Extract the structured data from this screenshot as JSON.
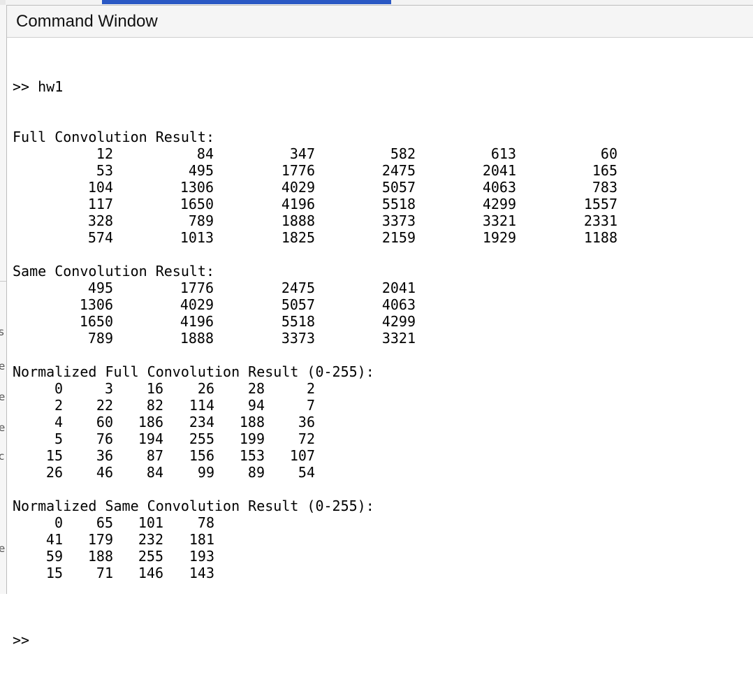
{
  "window": {
    "title": "Command Window"
  },
  "left_panel_fragments": [
    "s",
    "e",
    "e",
    "e",
    "c",
    "e"
  ],
  "console": {
    "command_line": ">> hw1",
    "prompt": ">>",
    "sections": [
      {
        "id": "full",
        "header": "Full Convolution Result:",
        "rows": [
          [
            "12",
            "84",
            "347",
            "582",
            "613",
            "60"
          ],
          [
            "53",
            "495",
            "1776",
            "2475",
            "2041",
            "165"
          ],
          [
            "104",
            "1306",
            "4029",
            "5057",
            "4063",
            "783"
          ],
          [
            "117",
            "1650",
            "4196",
            "5518",
            "4299",
            "1557"
          ],
          [
            "328",
            "789",
            "1888",
            "3373",
            "3321",
            "2331"
          ],
          [
            "574",
            "1013",
            "1825",
            "2159",
            "1929",
            "1188"
          ]
        ]
      },
      {
        "id": "same",
        "header": "Same Convolution Result:",
        "rows": [
          [
            "495",
            "1776",
            "2475",
            "2041"
          ],
          [
            "1306",
            "4029",
            "5057",
            "4063"
          ],
          [
            "1650",
            "4196",
            "5518",
            "4299"
          ],
          [
            "789",
            "1888",
            "3373",
            "3321"
          ]
        ]
      },
      {
        "id": "norm_full",
        "header": "Normalized Full Convolution Result (0-255):",
        "rows": [
          [
            "0",
            "3",
            "16",
            "26",
            "28",
            "2"
          ],
          [
            "2",
            "22",
            "82",
            "114",
            "94",
            "7"
          ],
          [
            "4",
            "60",
            "186",
            "234",
            "188",
            "36"
          ],
          [
            "5",
            "76",
            "194",
            "255",
            "199",
            "72"
          ],
          [
            "15",
            "36",
            "87",
            "156",
            "153",
            "107"
          ],
          [
            "26",
            "46",
            "84",
            "99",
            "89",
            "54"
          ]
        ]
      },
      {
        "id": "norm_same",
        "header": "Normalized Same Convolution Result (0-255):",
        "rows": [
          [
            "0",
            "65",
            "101",
            "78"
          ],
          [
            "41",
            "179",
            "232",
            "181"
          ],
          [
            "59",
            "188",
            "255",
            "193"
          ],
          [
            "15",
            "71",
            "146",
            "143"
          ]
        ]
      }
    ]
  }
}
